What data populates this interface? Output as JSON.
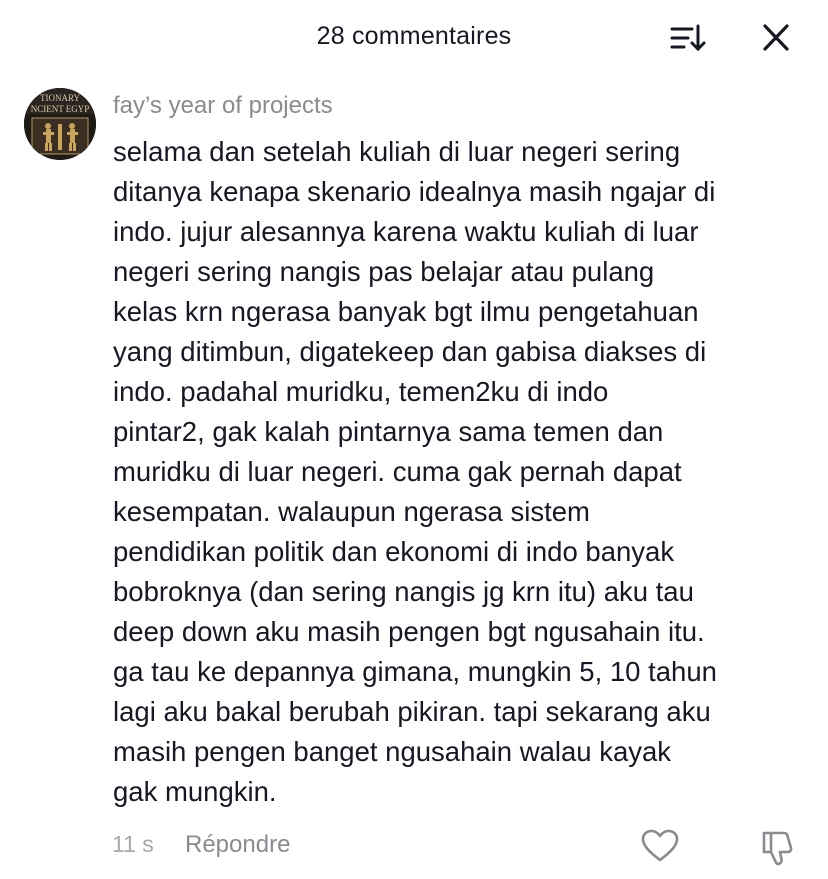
{
  "header": {
    "title": "28 commentaires",
    "sort_icon": "sort-icon",
    "close_icon": "close-icon"
  },
  "comment": {
    "username": "fay’s year of projects",
    "avatar_icon": "avatar-ancient-egypt-book",
    "avatar_text": [
      "TIONARY",
      "NCIENT EGYP"
    ],
    "text_lines": [
      "selama dan setelah kuliah di luar negeri sering",
      "ditanya kenapa skenario idealnya masih ngajar di",
      "indo. jujur alesannya karena waktu kuliah di luar",
      "negeri sering nangis pas belajar atau pulang",
      "kelas krn ngerasa banyak bgt ilmu pengetahuan",
      "yang ditimbun, digatekeep dan gabisa diakses di",
      "indo. padahal muridku, temen2ku di indo",
      "pintar2, gak kalah pintarnya sama temen dan",
      "muridku di luar negeri. cuma gak pernah dapat",
      "kesempatan. walaupun ngerasa sistem",
      "pendidikan politik dan ekonomi di indo banyak",
      "bobroknya (dan sering nangis jg krn itu) aku tau",
      "deep down aku masih pengen bgt ngusahain itu.",
      "ga tau ke depannya gimana, mungkin 5, 10 tahun",
      "lagi aku bakal berubah pikiran. tapi sekarang aku",
      "masih pengen banget ngusahain walau kayak",
      "gak mungkin."
    ],
    "timestamp": "11 s",
    "reply_label": "Répondre",
    "like_icon": "heart-icon",
    "dislike_icon": "thumbs-down-icon"
  },
  "colors": {
    "text_primary": "#161823",
    "text_secondary": "#8a8b91",
    "text_tertiary": "#a7a8ad",
    "background": "#ffffff"
  }
}
